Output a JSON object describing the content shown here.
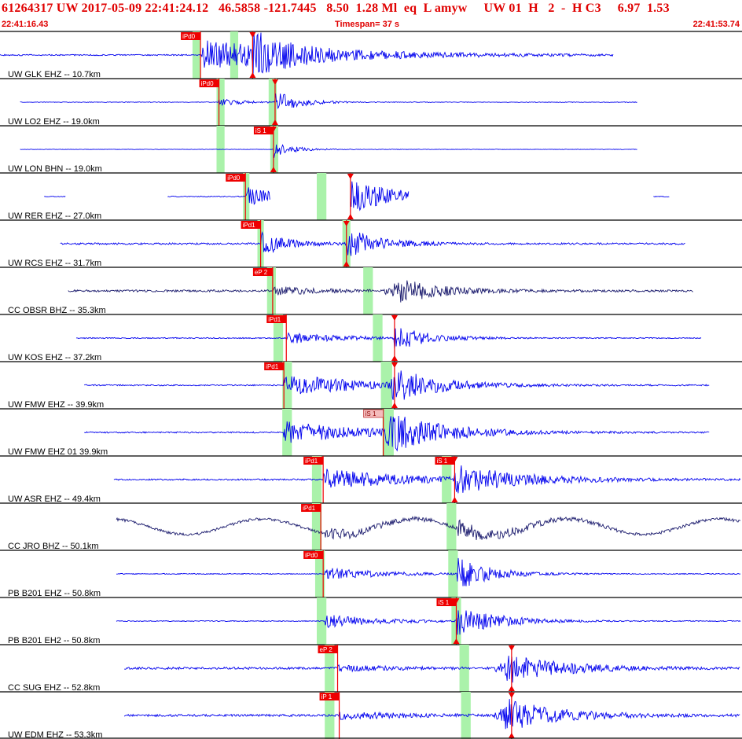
{
  "header": {
    "event_line": "61264317 UW 2017-05-09 22:41:24.12   46.5858 -121.7445   8.50  1.28 Ml  eq  L amyw     UW 01  H   2  -  H C3     6.97  1.53",
    "time_start": "22:41:16.43",
    "timespan": "Timespan=  37 s",
    "time_end": "22:41:53.74"
  },
  "colors": {
    "trace": "#0000ee",
    "trace_broadband": "#1c1c6e",
    "pick": "#ee0000",
    "pick_label_bg": "#ee0000",
    "pick_label_bg_light": "#f4bcbc",
    "window": "#aaf2aa",
    "frame": "#000000",
    "header_text": "#e00000"
  },
  "chart_data": {
    "type": "seismogram",
    "time_range_s": [
      0,
      37
    ],
    "channels": [
      {
        "label": "UW GLK EHZ -- 10.7km",
        "trace_s": [
          0,
          77
        ],
        "windows": [
          [
            24.5,
            25.5
          ],
          [
            29.2,
            30.2
          ]
        ],
        "picks": [
          {
            "label": "iPd0",
            "t": 25.5
          },
          {
            "label": "",
            "t": 32.0,
            "type": "S",
            "marker": true
          }
        ],
        "events": [
          {
            "t": 25.5,
            "amp": 0.55,
            "decay": 0.07,
            "coda": 0.12
          },
          {
            "t": 32.0,
            "amp": 0.8,
            "decay": 0.25
          }
        ],
        "noise": 0.03
      },
      {
        "label": "UW LO2 EHZ -- 19.0km",
        "trace_s": [
          3,
          80
        ],
        "windows": [
          [
            27.5,
            28.5
          ],
          [
            34.0,
            35.0
          ]
        ],
        "picks": [
          {
            "label": "iPd0",
            "t": 27.8
          },
          {
            "label": "",
            "t": 34.8,
            "type": "S",
            "marker": true
          }
        ],
        "events": [
          {
            "t": 27.8,
            "amp": 0.15,
            "decay": 0.3
          },
          {
            "t": 34.8,
            "amp": 0.5,
            "decay": 0.35
          }
        ],
        "noise": 0.015
      },
      {
        "label": "UW LON BHN -- 19.0km",
        "trace_s": [
          3,
          80
        ],
        "windows": [
          [
            27.5,
            28.5
          ],
          [
            34.2,
            35.2
          ]
        ],
        "picks": [
          {
            "label": "iS 1",
            "t": 34.6,
            "marker": true
          }
        ],
        "events": [
          {
            "t": 34.6,
            "amp": 0.45,
            "decay": 0.45
          }
        ],
        "noise": 0.01
      },
      {
        "label": "UW RER EHZ -- 27.0km",
        "trace_s": [
          6,
          83
        ],
        "segments": [
          [
            6,
            8.7
          ],
          [
            21.4,
            34.2
          ],
          [
            44.2,
            51.5
          ],
          [
            82,
            84
          ]
        ],
        "windows": [
          [
            30.8,
            31.6
          ],
          [
            40.0,
            41.2
          ]
        ],
        "picks": [
          {
            "label": "iPd0",
            "t": 31.1
          },
          {
            "label": "",
            "t": 44.2,
            "type": "S",
            "marker": true
          }
        ],
        "events": [
          {
            "t": 31.1,
            "amp": 0.45,
            "decay": 0.25
          },
          {
            "t": 44.2,
            "amp": 0.7,
            "decay": 0.15
          }
        ],
        "noise": 0.02
      },
      {
        "label": "UW RCS EHZ -- 31.7km",
        "trace_s": [
          8,
          86
        ],
        "windows": [
          [
            32.6,
            33.4
          ],
          [
            43.2,
            44.2
          ]
        ],
        "picks": [
          {
            "label": "iPd1",
            "t": 33.0
          },
          {
            "label": "",
            "t": 43.7,
            "type": "S",
            "marker": true
          }
        ],
        "events": [
          {
            "t": 33.0,
            "amp": 0.55,
            "decay": 0.3
          },
          {
            "t": 43.7,
            "amp": 0.7,
            "decay": 0.25
          }
        ],
        "noise": 0.04
      },
      {
        "label": "CC OBSR BHZ -- 35.3km",
        "trace_s": [
          9,
          87
        ],
        "windows": [
          [
            33.8,
            34.9
          ],
          [
            45.8,
            47.0
          ]
        ],
        "picks": [
          {
            "label": "eP 2",
            "t": 34.5
          }
        ],
        "events": [
          {
            "t": 34.5,
            "amp": 0.2,
            "decay": 0.2
          },
          {
            "t": 50.0,
            "amp": 0.6,
            "decay": 0.2,
            "width": 2.0
          }
        ],
        "noise": 0.05,
        "broadband": true
      },
      {
        "label": "UW KOS EHZ -- 37.2km",
        "trace_s": [
          10,
          88
        ],
        "windows": [
          [
            34.6,
            35.8
          ],
          [
            47.0,
            48.2
          ]
        ],
        "picks": [
          {
            "label": "iPd1",
            "t": 36.2
          },
          {
            "label": "",
            "t": 49.7,
            "type": "S",
            "marker": true
          }
        ],
        "events": [
          {
            "t": 36.2,
            "amp": 0.25,
            "decay": 0.15
          },
          {
            "t": 49.7,
            "amp": 0.55,
            "decay": 0.25
          }
        ],
        "noise": 0.025
      },
      {
        "label": "UW FMW EHZ -- 39.9km",
        "trace_s": [
          11,
          89
        ],
        "windows": [
          [
            35.7,
            36.9
          ],
          [
            48.0,
            49.4
          ]
        ],
        "picks": [
          {
            "label": "iPd1",
            "t": 35.9
          },
          {
            "label": "",
            "t": 49.7,
            "type": "S",
            "marker": true
          }
        ],
        "events": [
          {
            "t": 35.9,
            "amp": 0.5,
            "decay": 0.1
          },
          {
            "t": 49.3,
            "amp": 0.75,
            "decay": 0.2
          }
        ],
        "noise": 0.03
      },
      {
        "label": "UW FMW EHZ 01 39.9km",
        "trace_s": [
          11,
          89
        ],
        "windows": [
          [
            35.7,
            36.9
          ],
          [
            48.2,
            49.6
          ]
        ],
        "picks": [
          {
            "label": "iS 1",
            "t": 48.3,
            "light": true
          }
        ],
        "events": [
          {
            "t": 35.9,
            "amp": 0.5,
            "decay": 0.1
          },
          {
            "t": 48.5,
            "amp": 0.85,
            "decay": 0.15
          }
        ],
        "noise": 0.03
      },
      {
        "label": "UW ASR EHZ -- 49.4km",
        "trace_s": [
          14.7,
          93
        ],
        "windows": [
          [
            39.4,
            40.6
          ],
          [
            55.6,
            56.8
          ]
        ],
        "picks": [
          {
            "label": "iPd1",
            "t": 40.8
          },
          {
            "label": "iS 1",
            "t": 57.2,
            "marker": true
          }
        ],
        "events": [
          {
            "t": 40.8,
            "amp": 0.5,
            "decay": 0.1
          },
          {
            "t": 57.2,
            "amp": 0.6,
            "decay": 0.12
          }
        ],
        "noise": 0.035
      },
      {
        "label": "CC JRO BHZ -- 50.1km",
        "trace_s": [
          15,
          93
        ],
        "windows": [
          [
            39.4,
            40.6
          ],
          [
            56.2,
            57.4
          ]
        ],
        "picks": [
          {
            "label": "iPd1",
            "t": 40.5
          }
        ],
        "events": [
          {
            "t": 41.0,
            "amp": 0.25,
            "decay": 0.15
          },
          {
            "t": 57.5,
            "amp": 0.35,
            "decay": 0.15
          }
        ],
        "noise": 0.06,
        "broadband": true,
        "sine": {
          "amp": 0.35,
          "period": 19.0
        }
      },
      {
        "label": "PB B201 EHZ -- 50.8km",
        "trace_s": [
          15,
          93
        ],
        "windows": [
          [
            39.8,
            41.0
          ],
          [
            56.4,
            57.6
          ]
        ],
        "picks": [
          {
            "label": "iPd0",
            "t": 40.8
          }
        ],
        "events": [
          {
            "t": 41.0,
            "amp": 0.3,
            "decay": 0.15
          },
          {
            "t": 57.5,
            "amp": 0.75,
            "decay": 0.25
          }
        ],
        "noise": 0.02
      },
      {
        "label": "PB B201 EH2 -- 50.8km",
        "trace_s": [
          15,
          93
        ],
        "windows": [
          [
            40.0,
            41.2
          ],
          [
            56.8,
            58.0
          ]
        ],
        "picks": [
          {
            "label": "iS 1",
            "t": 57.4,
            "marker": true
          }
        ],
        "events": [
          {
            "t": 41.0,
            "amp": 0.3,
            "decay": 0.15
          },
          {
            "t": 57.4,
            "amp": 0.7,
            "decay": 0.2
          }
        ],
        "noise": 0.02
      },
      {
        "label": "CC SUG EHZ -- 52.8km",
        "trace_s": [
          16,
          94
        ],
        "windows": [
          [
            41.0,
            42.2
          ],
          [
            57.8,
            59.0
          ]
        ],
        "picks": [
          {
            "label": "eP 2",
            "t": 42.6
          },
          {
            "label": "",
            "t": 64.3,
            "type": "S",
            "marker": true
          }
        ],
        "events": [
          {
            "t": 42.6,
            "amp": 0.12,
            "decay": 0.15
          },
          {
            "t": 63.5,
            "amp": 0.7,
            "decay": 0.15,
            "width": 1.5
          }
        ],
        "noise": 0.05
      },
      {
        "label": "UW EDM EHZ -- 53.3km",
        "trace_s": [
          16,
          94
        ],
        "windows": [
          [
            41.0,
            42.2
          ],
          [
            58.0,
            59.2
          ]
        ],
        "picks": [
          {
            "label": "iP 1",
            "t": 42.8
          },
          {
            "label": "",
            "t": 64.3,
            "type": "S",
            "marker": true
          }
        ],
        "events": [
          {
            "t": 42.8,
            "amp": 0.2,
            "decay": 0.15
          },
          {
            "t": 63.5,
            "amp": 0.75,
            "decay": 0.15,
            "width": 1.5
          }
        ],
        "noise": 0.05
      }
    ]
  }
}
